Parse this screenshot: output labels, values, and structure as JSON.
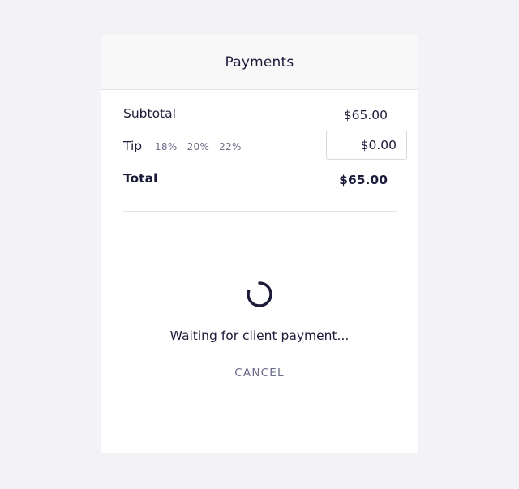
{
  "header": {
    "title": "Payments"
  },
  "summary": {
    "subtotal_label": "Subtotal",
    "subtotal_value": "$65.00",
    "tip_label": "Tip",
    "tip_options": [
      "18%",
      "20%",
      "22%"
    ],
    "tip_value": "$0.00",
    "total_label": "Total",
    "total_value": "$65.00"
  },
  "status": {
    "message": "Waiting for client payment...",
    "spinner_icon": "loading-spinner-icon"
  },
  "actions": {
    "cancel_label": "CANCEL"
  },
  "colors": {
    "background": "#f3f3f7",
    "card": "#ffffff",
    "header": "#f8f8f8",
    "text": "#1c1c3a",
    "muted": "#6b6b8a"
  }
}
